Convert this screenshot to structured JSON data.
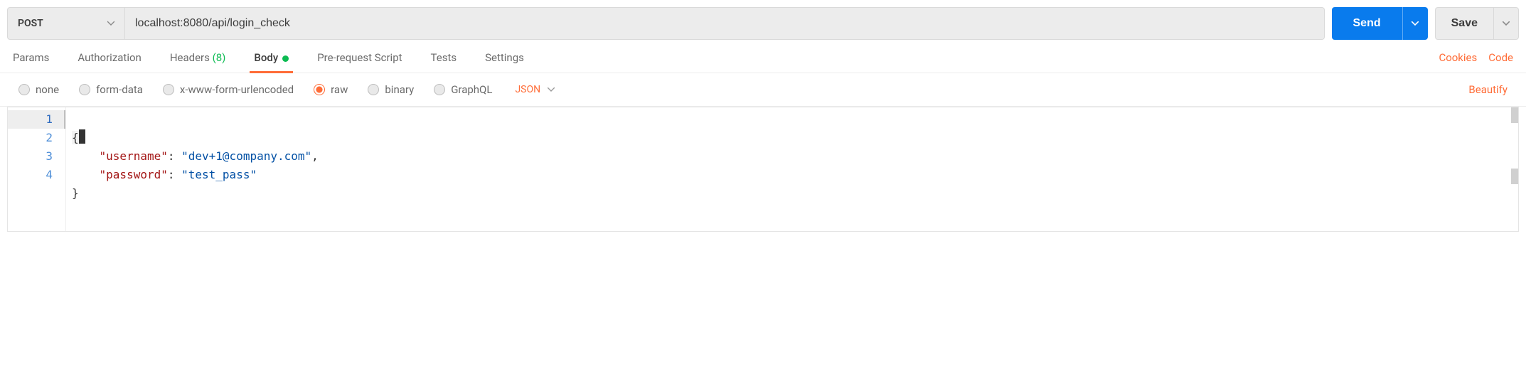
{
  "request": {
    "method": "POST",
    "url": "localhost:8080/api/login_check"
  },
  "actions": {
    "send_label": "Send",
    "save_label": "Save"
  },
  "tabs": {
    "items": [
      {
        "label": "Params"
      },
      {
        "label": "Authorization"
      },
      {
        "label": "Headers",
        "count": "(8)"
      },
      {
        "label": "Body",
        "active": true,
        "has_dot": true
      },
      {
        "label": "Pre-request Script"
      },
      {
        "label": "Tests"
      },
      {
        "label": "Settings"
      }
    ],
    "right_links": {
      "cookies": "Cookies",
      "code": "Code"
    }
  },
  "body_type": {
    "options": [
      {
        "label": "none",
        "selected": false
      },
      {
        "label": "form-data",
        "selected": false
      },
      {
        "label": "x-www-form-urlencoded",
        "selected": false
      },
      {
        "label": "raw",
        "selected": true
      },
      {
        "label": "binary",
        "selected": false
      },
      {
        "label": "GraphQL",
        "selected": false
      }
    ],
    "language": "JSON",
    "beautify": "Beautify"
  },
  "editor": {
    "line_numbers": [
      "1",
      "2",
      "3",
      "4"
    ],
    "current_line": 1,
    "content": {
      "username_key": "\"username\"",
      "username_val": "\"dev+1@company.com\"",
      "password_key": "\"password\"",
      "password_val": "\"test_pass\""
    }
  }
}
